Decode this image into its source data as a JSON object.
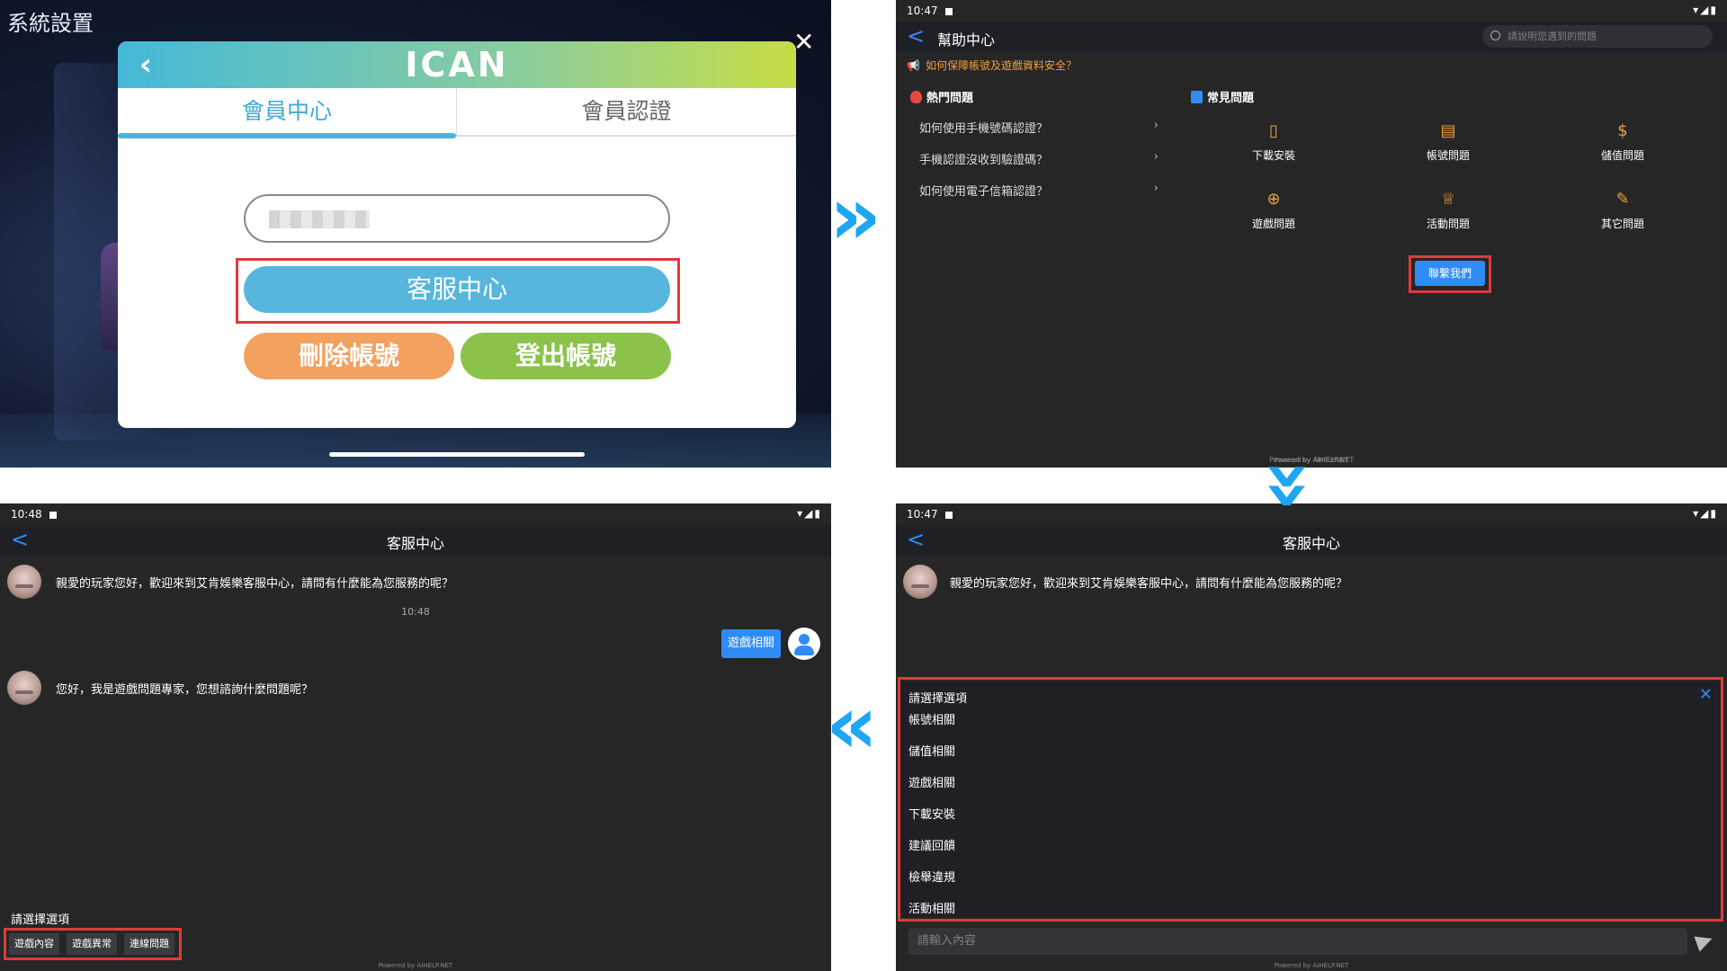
{
  "panel_settings": {
    "system_title": "系統設置",
    "close_glyph": "✕",
    "back_glyph": "‹",
    "logo_text": "ICAN",
    "tabs": [
      {
        "label": "會員中心",
        "active": true
      },
      {
        "label": "會員認證",
        "active": false
      }
    ],
    "buttons": {
      "customer_service": "客服中心",
      "delete_account": "刪除帳號",
      "logout": "登出帳號"
    },
    "colors": {
      "header_start": "#45b9d9",
      "header_end": "#c6dd44",
      "service": "#57b6dd",
      "delete": "#f3a15f",
      "logout": "#8bc34a",
      "highlight": "#e03a3a"
    }
  },
  "panel_help": {
    "status": {
      "time": "10:47",
      "icons": "▾◢▮"
    },
    "back_glyph": "<",
    "title": "幫助中心",
    "search_placeholder": "請說明您遇到的問題",
    "notice": "如何保障帳號及遊戲資料安全？",
    "hot_title": "熱門問題",
    "faq_title": "常見問題",
    "hot_items": [
      {
        "label": "如何使用手機號碼認證？",
        "chev": "›"
      },
      {
        "label": "手機認證沒收到驗證碼？",
        "chev": "›"
      },
      {
        "label": "如何使用電子信箱認證？",
        "chev": "›"
      }
    ],
    "categories": [
      {
        "label": "下載安裝",
        "icon": "▯"
      },
      {
        "label": "帳號問題",
        "icon": "▤"
      },
      {
        "label": "儲值問題",
        "icon": "$"
      },
      {
        "label": "遊戲問題",
        "icon": "⊕"
      },
      {
        "label": "活動問題",
        "icon": "♕"
      },
      {
        "label": "其它問題",
        "icon": "✎"
      }
    ],
    "contact_button": "聯繫我們",
    "powered": "Powered by AIHELP.NET"
  },
  "panel_options": {
    "status": {
      "time": "10:47",
      "icons": "▾◢▮"
    },
    "back_glyph": "<",
    "title": "客服中心",
    "welcome": "親愛的玩家您好，歡迎來到艾肯娛樂客服中心，請問有什麼能為您服務的呢？",
    "sheet_title": "請選擇選項",
    "sheet_close": "✕",
    "options": [
      "帳號相關",
      "儲值相關",
      "遊戲相關",
      "下載安裝",
      "建議回饋",
      "檢舉違規",
      "活動相關"
    ],
    "input_placeholder": "請輸入內容",
    "powered": "Powered by AIHELP.NET"
  },
  "panel_chat": {
    "status": {
      "time": "10:48",
      "icons": "▾◢▮"
    },
    "back_glyph": "<",
    "title": "客服中心",
    "welcome": "親愛的玩家您好，歡迎來到艾肯娛樂客服中心，請問有什麼能為您服務的呢？",
    "timestamp": "10:48",
    "user_message": "遊戲相關",
    "bot_reply": "您好，我是遊戲問題專家，您想諮詢什麼問題呢？",
    "choose_label": "請選擇選項",
    "chips": [
      "遊戲內容",
      "遊戲異常",
      "連線問題"
    ],
    "powered": "Powered by AIHELP.NET"
  },
  "flow_arrows": {
    "right": "»",
    "down": "»",
    "left": "«",
    "color": "#1fa6f2"
  },
  "overlap_text": "Powered by AIHELP.NET"
}
